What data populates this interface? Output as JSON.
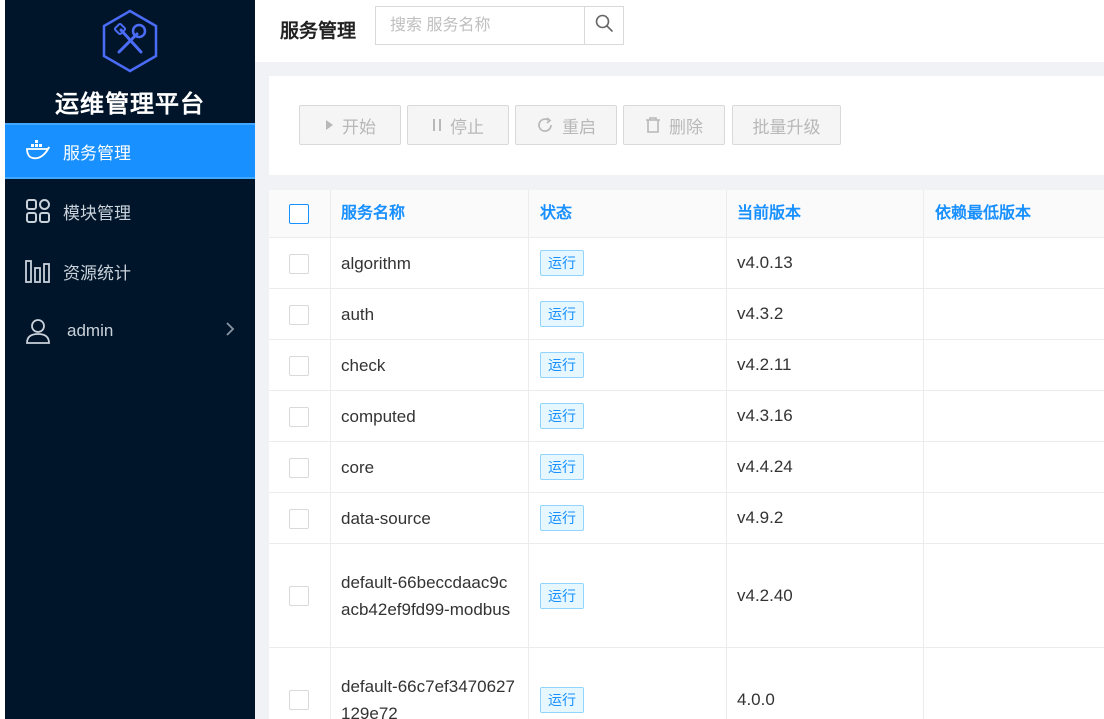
{
  "app": {
    "title": "运维管理平台"
  },
  "sidebar": {
    "items": [
      {
        "label": "服务管理",
        "icon": "docker-icon",
        "active": true
      },
      {
        "label": "模块管理",
        "icon": "grid-icon"
      },
      {
        "label": "资源统计",
        "icon": "bar-chart-icon"
      },
      {
        "label": "admin",
        "icon": "user-icon",
        "chevron": "chevron-right-icon"
      }
    ]
  },
  "header": {
    "title": "服务管理",
    "search_placeholder": "搜索 服务名称",
    "search_icon": "search-icon"
  },
  "toolbar": {
    "start_label": "开始",
    "stop_label": "停止",
    "restart_label": "重启",
    "delete_label": "删除",
    "batch_upgrade_label": "批量升级"
  },
  "table": {
    "columns": [
      "服务名称",
      "状态",
      "当前版本",
      "依赖最低版本"
    ],
    "rows": [
      {
        "name": "algorithm",
        "status": "运行",
        "version": "v4.0.13",
        "min_dep": ""
      },
      {
        "name": "auth",
        "status": "运行",
        "version": "v4.3.2",
        "min_dep": ""
      },
      {
        "name": "check",
        "status": "运行",
        "version": "v4.2.11",
        "min_dep": ""
      },
      {
        "name": "computed",
        "status": "运行",
        "version": "v4.3.16",
        "min_dep": ""
      },
      {
        "name": "core",
        "status": "运行",
        "version": "v4.4.24",
        "min_dep": ""
      },
      {
        "name": "data-source",
        "status": "运行",
        "version": "v4.9.2",
        "min_dep": ""
      },
      {
        "name": "default-66beccdaac9cacb42ef9fd99-modbus",
        "status": "运行",
        "version": "v4.2.40",
        "min_dep": ""
      },
      {
        "name": "default-66c7ef3470627129e72",
        "status": "运行",
        "version": "4.0.0",
        "min_dep": ""
      }
    ]
  },
  "colors": {
    "sidebar_bg": "#001529",
    "accent": "#1890ff",
    "tag_bg": "#e6f7ff"
  }
}
